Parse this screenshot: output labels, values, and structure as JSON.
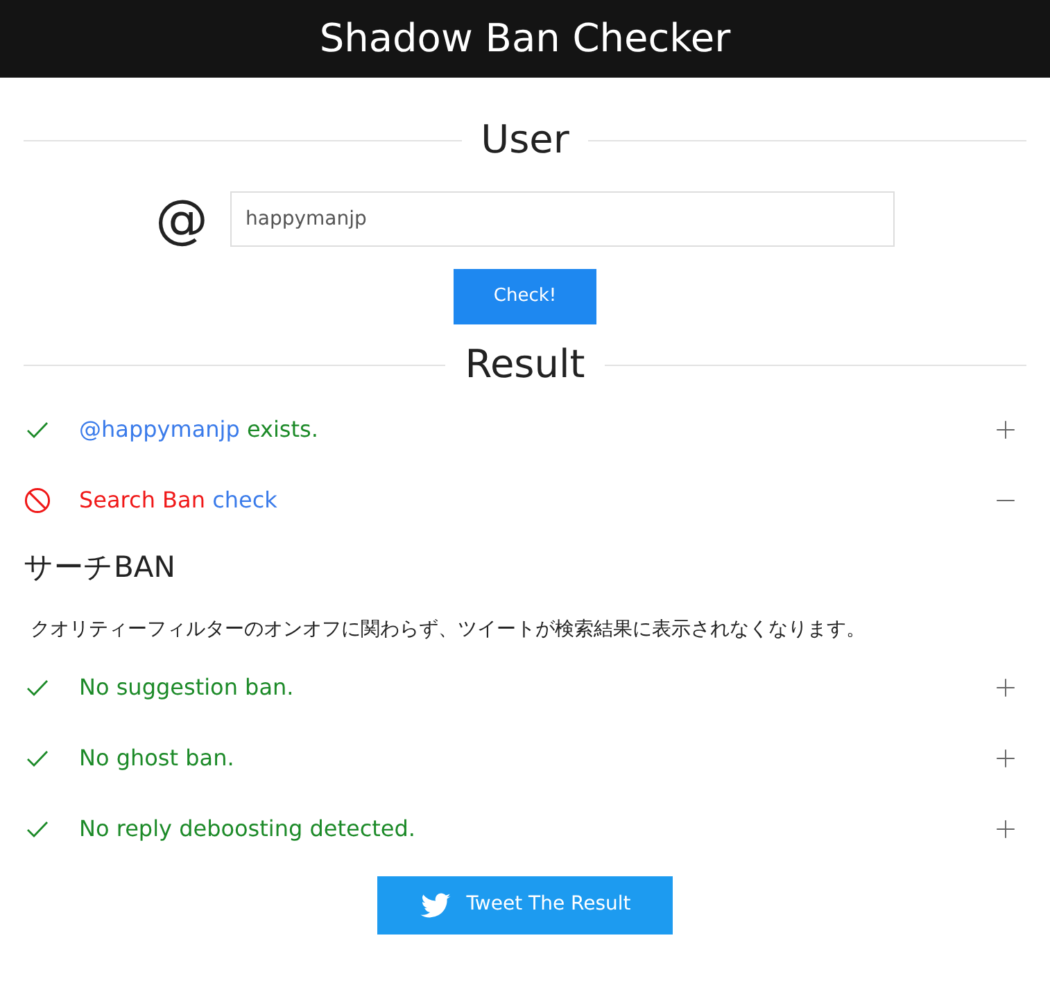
{
  "header": {
    "title": "Shadow Ban Checker"
  },
  "user_section": {
    "heading": "User",
    "at_sign": "@",
    "username_field": {
      "value": "happymanjp"
    },
    "check_button": "Check!"
  },
  "result_section": {
    "heading": "Result"
  },
  "results": [
    {
      "kind": "pass",
      "expanded": false,
      "parts": [
        {
          "text": "@happymanjp",
          "kind": "link"
        },
        {
          "text": " exists.",
          "kind": "plain"
        }
      ]
    },
    {
      "kind": "fail",
      "expanded": true,
      "parts": [
        {
          "text": "Search Ban",
          "kind": "plain"
        },
        {
          "text": " check",
          "kind": "link"
        }
      ],
      "detail": {
        "heading": "サーチBAN",
        "description": "クオリティーフィルターのオンオフに関わらず、ツイートが検索結果に表示されなくなります。"
      }
    },
    {
      "kind": "pass",
      "expanded": false,
      "parts": [
        {
          "text": "No suggestion ban.",
          "kind": "plain"
        }
      ]
    },
    {
      "kind": "pass",
      "expanded": false,
      "parts": [
        {
          "text": "No ghost ban.",
          "kind": "plain"
        }
      ]
    },
    {
      "kind": "pass",
      "expanded": false,
      "parts": [
        {
          "text": "No reply deboosting detected.",
          "kind": "plain"
        }
      ]
    }
  ],
  "tweet_button": "Tweet The Result"
}
